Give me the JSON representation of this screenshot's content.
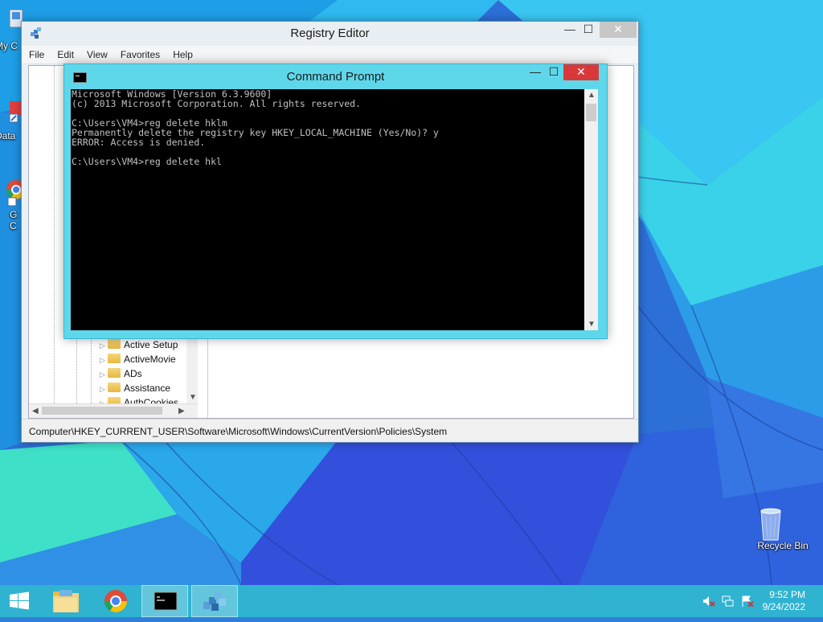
{
  "desktop": {
    "icons": [
      {
        "label": "My C"
      },
      {
        "label": "Data"
      },
      {
        "label": "G\nC"
      },
      {
        "label": "Recycle Bin"
      }
    ]
  },
  "regedit": {
    "title": "Registry Editor",
    "menu": [
      "File",
      "Edit",
      "View",
      "Favorites",
      "Help"
    ],
    "tree_items": [
      "Active Setup",
      "ActiveMovie",
      "ADs",
      "Assistance",
      "AuthCookies"
    ],
    "status": "Computer\\HKEY_CURRENT_USER\\Software\\Microsoft\\Windows\\CurrentVersion\\Policies\\System"
  },
  "cmd": {
    "title": "Command Prompt",
    "lines": [
      "Microsoft Windows [Version 6.3.9600]",
      "(c) 2013 Microsoft Corporation. All rights reserved.",
      "",
      "C:\\Users\\VM4>reg delete hklm",
      "Permanently delete the registry key HKEY_LOCAL_MACHINE (Yes/No)? y",
      "ERROR: Access is denied.",
      "",
      "C:\\Users\\VM4>reg delete hkl"
    ]
  },
  "window_controls": {
    "minimize": "—",
    "maximize": "☐",
    "close": "✕"
  },
  "taskbar": {
    "time": "9:52 PM",
    "date": "9/24/2022",
    "buttons": [
      "start-button",
      "file-explorer",
      "chrome",
      "command-prompt",
      "registry-editor"
    ]
  },
  "colors": {
    "taskbar": "#2fb3d1",
    "cmd_frame": "#5fd7ea",
    "close_red": "#d9383b"
  }
}
